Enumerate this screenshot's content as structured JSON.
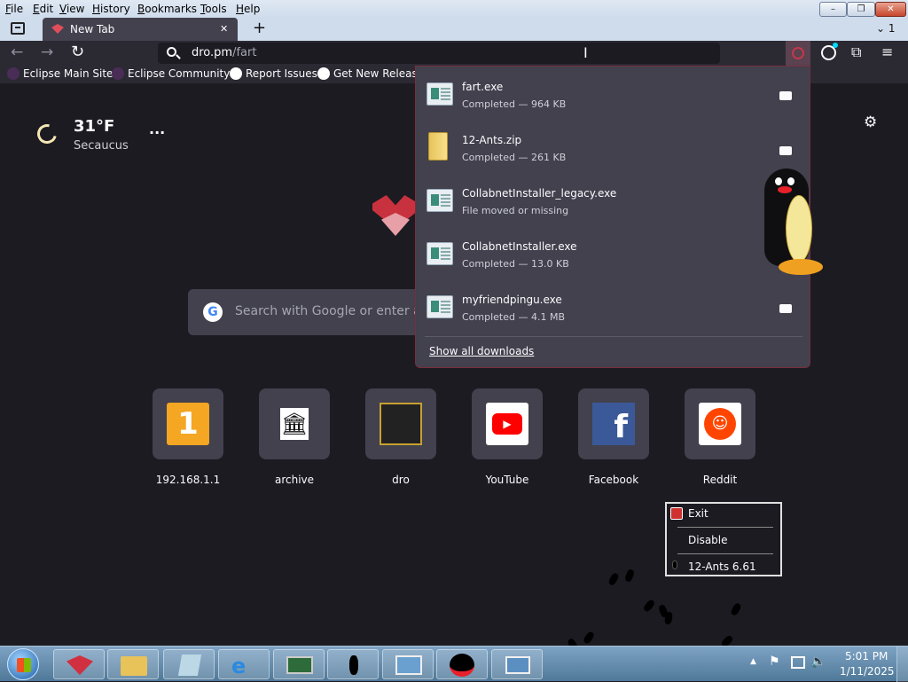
{
  "menu": [
    "File",
    "Edit",
    "View",
    "History",
    "Bookmarks",
    "Tools",
    "Help"
  ],
  "window_controls": {
    "minimize": "–",
    "maximize": "❐",
    "close": "✕"
  },
  "tab": {
    "title": "New Tab",
    "close": "✕",
    "new_tab": "+",
    "list_count": "1"
  },
  "url": {
    "host": "dro.pm",
    "path": "/fart"
  },
  "bookmarks": [
    "Eclipse Main Site",
    "Eclipse Community",
    "Report Issues",
    "Get New Releases"
  ],
  "weather": {
    "temp": "31°F",
    "city": "Secaucus",
    "more": "···"
  },
  "search": {
    "placeholder": "Search with Google or enter ac"
  },
  "top_sites": [
    {
      "label": "192.168.1.1"
    },
    {
      "label": "archive"
    },
    {
      "label": "dro"
    },
    {
      "label": "YouTube"
    },
    {
      "label": "Facebook"
    },
    {
      "label": "Reddit"
    }
  ],
  "downloads": {
    "items": [
      {
        "name": "fart.exe",
        "status": "Completed — 964 KB"
      },
      {
        "name": "12-Ants.zip",
        "status": "Completed — 261 KB"
      },
      {
        "name": "CollabnetInstaller_legacy.exe",
        "status": "File moved or missing"
      },
      {
        "name": "CollabnetInstaller.exe",
        "status": "Completed — 13.0 KB"
      },
      {
        "name": "myfriendpingu.exe",
        "status": "Completed — 4.1 MB"
      }
    ],
    "show_all": "Show all downloads"
  },
  "context_menu": {
    "exit": "Exit",
    "disable": "Disable",
    "version": "12-Ants 6.61"
  },
  "clock": {
    "time": "5:01 PM",
    "date": "1/11/2025"
  },
  "colors": {
    "accent": "#e22850",
    "background": "#1c1b22",
    "panel": "#42414d"
  }
}
